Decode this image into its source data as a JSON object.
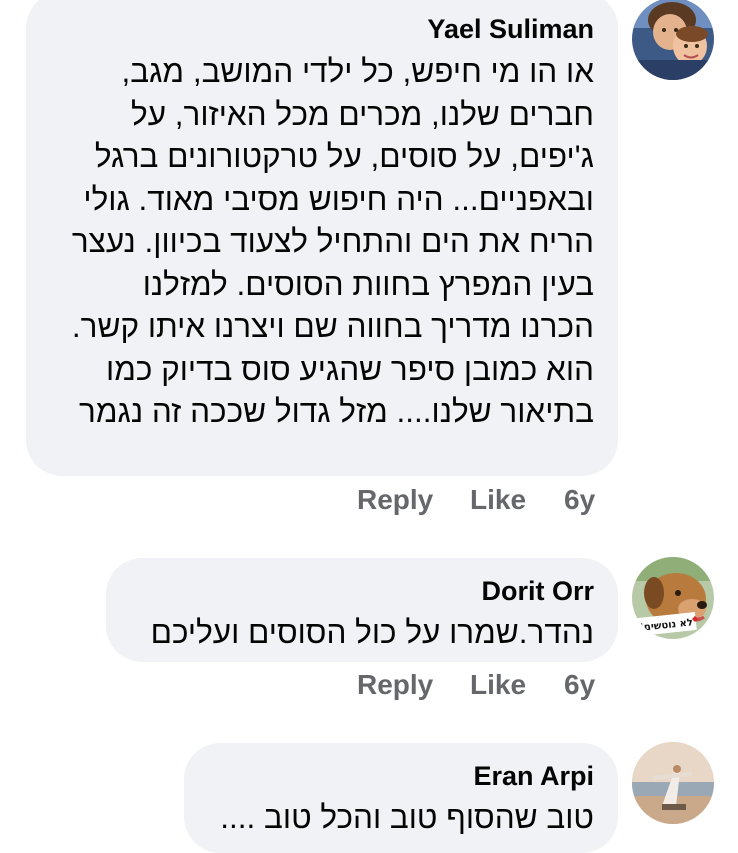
{
  "comments": [
    {
      "author": "Yael Suliman",
      "lines": [
        "או הו מי חיפש, כל ילדי המושב, מגב,",
        "חברים שלנו, מכרים מכל האיזור, על",
        "ג'יפים, על סוסים, על טרקטורונים ברגל",
        "ובאפניים... היה חיפוש מסיבי מאוד. גולי",
        "הריח את הים והתחיל לצעוד בכיוון. נעצר",
        "בעין המפרץ בחוות הסוסים. למזלנו",
        "הכרנו מדריך בחווה שם ויצרנו איתו קשר.",
        "הוא כמובן סיפר שהגיע סוס בדיוק כמו",
        "בתיאור שלנו.... מזל גדול שככה זה נגמר"
      ],
      "reply": "Reply",
      "like": "Like",
      "time": "6y"
    },
    {
      "author": "Dorit Orr",
      "lines": [
        "נהדר.שמרו על כול הסוסים ועליכם"
      ],
      "reply": "Reply",
      "like": "Like",
      "time": "6y"
    },
    {
      "author": "Eran Arpi",
      "lines": [
        "טוב שהסוף טוב והכל טוב ...."
      ]
    }
  ],
  "avatar_badge_text": "לא נוטשים!",
  "colors": {
    "bubble": "#f0f2f5",
    "text": "#050505",
    "secondary": "#65676b"
  },
  "icons": [
    "profile-photo-yael",
    "profile-photo-dorit-dog",
    "profile-photo-eran-beach"
  ]
}
